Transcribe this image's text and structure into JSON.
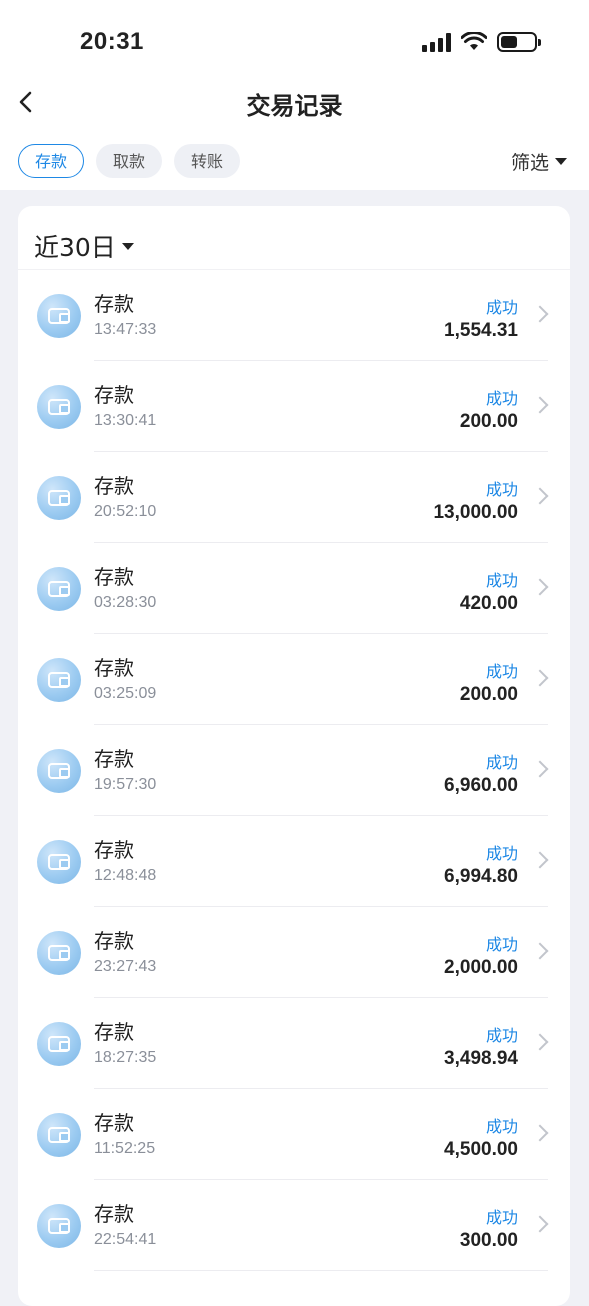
{
  "status_bar": {
    "time": "20:31"
  },
  "header": {
    "title": "交易记录"
  },
  "tabs": [
    {
      "label": "存款",
      "active": true
    },
    {
      "label": "取款",
      "active": false
    },
    {
      "label": "转账",
      "active": false
    }
  ],
  "filter": {
    "label": "筛选"
  },
  "date_range": {
    "label": "近30日"
  },
  "colors": {
    "accent": "#1e88e5",
    "status_success": "#1e88e5"
  },
  "transactions": [
    {
      "type": "存款",
      "time": "13:47:33",
      "status": "成功",
      "amount": "1,554.31"
    },
    {
      "type": "存款",
      "time": "13:30:41",
      "status": "成功",
      "amount": "200.00"
    },
    {
      "type": "存款",
      "time": "20:52:10",
      "status": "成功",
      "amount": "13,000.00"
    },
    {
      "type": "存款",
      "time": "03:28:30",
      "status": "成功",
      "amount": "420.00"
    },
    {
      "type": "存款",
      "time": "03:25:09",
      "status": "成功",
      "amount": "200.00"
    },
    {
      "type": "存款",
      "time": "19:57:30",
      "status": "成功",
      "amount": "6,960.00"
    },
    {
      "type": "存款",
      "time": "12:48:48",
      "status": "成功",
      "amount": "6,994.80"
    },
    {
      "type": "存款",
      "time": "23:27:43",
      "status": "成功",
      "amount": "2,000.00"
    },
    {
      "type": "存款",
      "time": "18:27:35",
      "status": "成功",
      "amount": "3,498.94"
    },
    {
      "type": "存款",
      "time": "11:52:25",
      "status": "成功",
      "amount": "4,500.00"
    },
    {
      "type": "存款",
      "time": "22:54:41",
      "status": "成功",
      "amount": "300.00"
    }
  ]
}
